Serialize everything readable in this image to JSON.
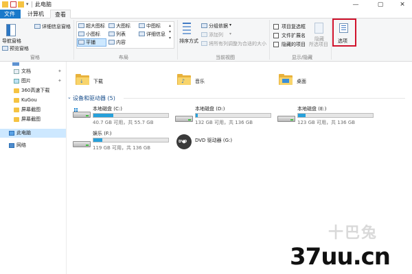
{
  "title": {
    "text": "此电脑"
  },
  "tabs": {
    "file": "文件",
    "computer": "计算机",
    "view": "查看"
  },
  "ribbon": {
    "pane": {
      "nav_pane": "导航窗格",
      "preview_pane": "预览窗格",
      "details_pane": "详细信息窗格",
      "group_label": "窗格"
    },
    "layout": {
      "extra_large": "超大图标",
      "large": "大图标",
      "medium": "中图标",
      "small": "小图标",
      "list": "列表",
      "details": "详细信息",
      "tiles": "平铺",
      "content": "内容",
      "group_label": "布局"
    },
    "current_view": {
      "sort_by": "排序方式",
      "group_by": "分组依据",
      "add_columns": "添加列",
      "size_all": "将所有列调整为合适的大小",
      "group_label": "当前视图"
    },
    "show_hide": {
      "item_checkboxes": "项目复选框",
      "file_extensions": "文件扩展名",
      "hidden_items": "隐藏的项目",
      "hide_selected": "隐藏",
      "hide_selected2": "所选项目",
      "group_label": "显示/隐藏"
    },
    "options": {
      "label": "选项"
    }
  },
  "sidebar": {
    "items": [
      "文档",
      "图片",
      "360高速下载",
      "KuGou",
      "屏幕截图",
      "屏幕截图"
    ],
    "this_pc": "此电脑",
    "network": "网络"
  },
  "folders": [
    "下载",
    "音乐",
    "桌面"
  ],
  "devices": {
    "header": "设备和驱动器 (5)",
    "drives": [
      {
        "name": "本地磁盘 (C:)",
        "capacity": "40.7 GB 可用，共 55.7 GB",
        "used_fraction": 0.27
      },
      {
        "name": "本地磁盘 (D:)",
        "capacity": "132 GB 可用，共 136 GB",
        "used_fraction": 0.03
      },
      {
        "name": "本地磁盘 (E:)",
        "capacity": "123 GB 可用，共 136 GB",
        "used_fraction": 0.1
      },
      {
        "name": "娱乐 (F:)",
        "capacity": "119 GB 可用，共 136 GB",
        "used_fraction": 0.12
      },
      {
        "name": "DVD 驱动器 (G:)"
      }
    ]
  },
  "watermark": {
    "site": "37uu.cn",
    "faded": "十巴兔"
  }
}
